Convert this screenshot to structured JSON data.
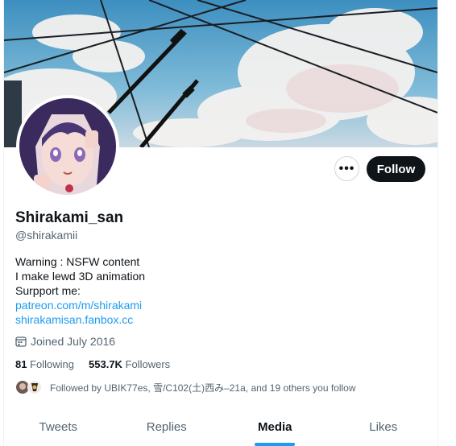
{
  "profile": {
    "display_name": "Shirakami_san",
    "handle": "@shirakamii",
    "bio_lines": [
      "Warning : NSFW content",
      "I make lewd 3D animation",
      "Surpport me:"
    ],
    "links": [
      "patreon.com/m/shirakami",
      "shirakamisan.fanbox.cc"
    ],
    "joined": "Joined July 2016",
    "following_count": "81",
    "following_label": "Following",
    "followers_count": "553.7K",
    "followers_label": "Followers",
    "followed_by": "Followed by UBIK77es, 雪/C102(土)西み–21a, and 19 others you follow"
  },
  "actions": {
    "more_label": "•••",
    "follow_label": "Follow"
  },
  "tabs": [
    {
      "label": "Tweets",
      "active": false
    },
    {
      "label": "Replies",
      "active": false
    },
    {
      "label": "Media",
      "active": true
    },
    {
      "label": "Likes",
      "active": false
    }
  ],
  "colors": {
    "accent": "#1d9bf0",
    "text": "#0f1419",
    "muted": "#536471",
    "button_dark": "#0f1419"
  },
  "icons": {
    "calendar": "calendar-icon",
    "more": "more-icon"
  }
}
